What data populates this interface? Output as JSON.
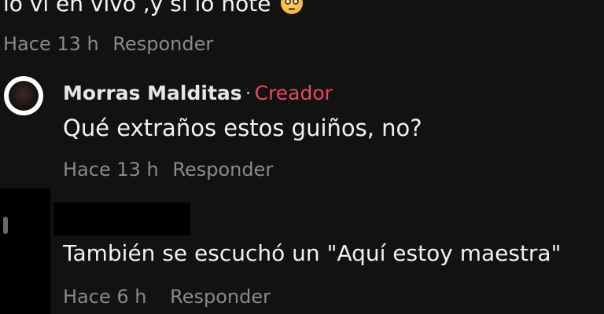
{
  "top_comment": {
    "text": "lo vi en vivo ,y si lo note",
    "emoji": "flushed-face",
    "time": "Hace 13 h",
    "reply_label": "Responder"
  },
  "creator_reply": {
    "author": "Morras Malditas",
    "separator": "·",
    "badge": "Creador",
    "text": "Qué extraños estos guiños, no?",
    "time": "Hace 13 h",
    "reply_label": "Responder"
  },
  "user_reply": {
    "author_redacted": true,
    "text": "También se escuchó un \"Aquí estoy maestra\"",
    "time": "Hace 6 h",
    "reply_label": "Responder"
  },
  "colors": {
    "background": "#121212",
    "creator_badge": "#e8475f",
    "meta_text": "#8a8a8a",
    "primary_text": "#f2f2f2"
  }
}
